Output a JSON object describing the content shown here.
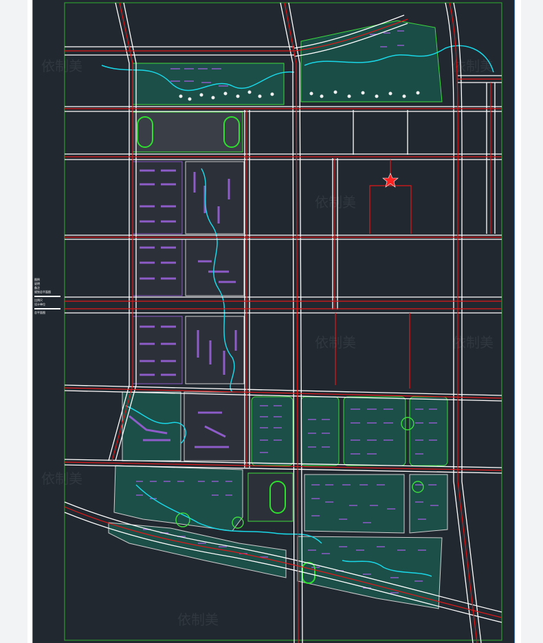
{
  "legend": {
    "lines": [
      "图例",
      "说明",
      "备注",
      "规划总平面图",
      "比例尺",
      "设计单位",
      "总平面图"
    ]
  },
  "watermark": "依制美",
  "colors": {
    "background": "#212830",
    "road_edge": "#ffffff",
    "road_centerline": "#e01818",
    "boundary": "#2f9a2f",
    "residential": "#8e5cc8",
    "landscape": "#1d6d5e",
    "green_outline": "#3ddc3d",
    "water": "#19d8e8",
    "sports_track": "#2ee02e",
    "marker": "#ff2020"
  },
  "icons": [
    "star-marker-icon",
    "sports-field-icon",
    "roundabout-icon"
  ]
}
